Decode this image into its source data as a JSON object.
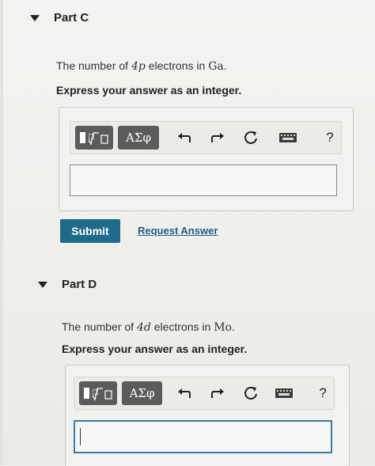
{
  "parts": [
    {
      "title": "Part C",
      "question_prefix": "The number of ",
      "question_orbital": "4p",
      "question_middle": " electrons in ",
      "question_element": "Ga",
      "question_suffix": ".",
      "instruction": "Express your answer as an integer.",
      "toolbar": {
        "greek_label": "ΑΣφ",
        "help_label": "?"
      },
      "submit_label": "Submit",
      "request_label": "Request Answer",
      "input_value": ""
    },
    {
      "title": "Part D",
      "question_prefix": "The number of ",
      "question_orbital": "4d",
      "question_middle": " electrons in ",
      "question_element": "Mo",
      "question_suffix": ".",
      "instruction": "Express your answer as an integer.",
      "toolbar": {
        "greek_label": "ΑΣφ",
        "help_label": "?"
      },
      "input_value": ""
    }
  ],
  "colors": {
    "submit_bg": "#1f6c8a",
    "link": "#1f5d86",
    "toolbar_button": "#5b5b5b"
  },
  "icons": [
    "caret-down-icon",
    "templates-icon",
    "undo-icon",
    "redo-icon",
    "reset-icon",
    "keyboard-icon",
    "help-icon"
  ]
}
